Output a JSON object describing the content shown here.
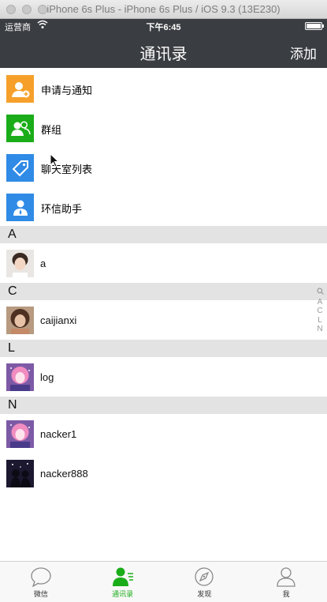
{
  "simulator": {
    "title": "iPhone 6s Plus - iPhone 6s Plus / iOS 9.3 (13E230)"
  },
  "status_bar": {
    "carrier": "运营商",
    "time": "下午6:45"
  },
  "nav": {
    "title": "通讯录",
    "add_label": "添加"
  },
  "functions": [
    {
      "label": "申请与通知",
      "icon": "add-person-icon",
      "color": "#f6a02b"
    },
    {
      "label": "群组",
      "icon": "group-icon",
      "color": "#1aad19"
    },
    {
      "label": "聊天室列表",
      "icon": "tag-icon",
      "color": "#2f8be6"
    },
    {
      "label": "环信助手",
      "icon": "person-icon",
      "color": "#2f8be6"
    }
  ],
  "sections": [
    {
      "letter": "A",
      "contacts": [
        {
          "name": "a"
        }
      ]
    },
    {
      "letter": "C",
      "contacts": [
        {
          "name": "caijianxi"
        }
      ]
    },
    {
      "letter": "L",
      "contacts": [
        {
          "name": "log"
        }
      ]
    },
    {
      "letter": "N",
      "contacts": [
        {
          "name": "nacker1"
        },
        {
          "name": "nacker888"
        }
      ]
    }
  ],
  "index_bar": [
    "A",
    "C",
    "L",
    "N"
  ],
  "tabs": [
    {
      "label": "微信",
      "icon": "chat-bubble-icon",
      "active": false
    },
    {
      "label": "通讯录",
      "icon": "contacts-icon",
      "active": true
    },
    {
      "label": "发现",
      "icon": "compass-icon",
      "active": false
    },
    {
      "label": "我",
      "icon": "profile-icon",
      "active": false
    }
  ],
  "colors": {
    "bar_dark": "#3a3d41",
    "active_tab": "#1aad19",
    "section_bg": "#e3e3e3"
  }
}
